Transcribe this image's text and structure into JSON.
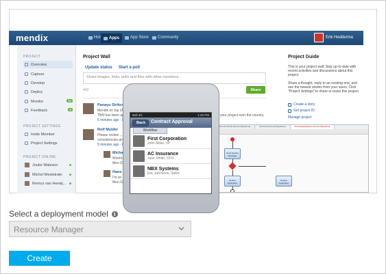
{
  "preview": {
    "app": {
      "logo": "mendix",
      "nav": [
        {
          "label": "Home"
        },
        {
          "label": "Apps"
        },
        {
          "label": "App Store"
        },
        {
          "label": "Community"
        }
      ],
      "user_name": "Erik Hedderma"
    },
    "sidebar": {
      "project_head": "PROJECT",
      "items": [
        {
          "label": "Overview"
        },
        {
          "label": "Capture"
        },
        {
          "label": "Develop"
        },
        {
          "label": "Deploy"
        },
        {
          "label": "Monitor",
          "badge": "42"
        },
        {
          "label": "Feedback",
          "badge": "5"
        }
      ],
      "settings_head": "PROJECT SETTINGS",
      "settings_items": [
        {
          "label": "Invite Member"
        },
        {
          "label": "Project Settings"
        }
      ],
      "online_head": "PROJECT ONLINE",
      "online_members": [
        {
          "name": "Jouke Waleson"
        },
        {
          "name": "Michel Weststrate"
        },
        {
          "name": "Remco van Herwij..."
        }
      ]
    },
    "wall": {
      "title": "Project Wall",
      "update_status": "Update status",
      "start_poll": "Start a poll",
      "share_placeholder": "Share images, links, polls and files with other members.",
      "share_button": "Share",
      "meta": "442",
      "posts": [
        {
          "name": "Panayu Sirikra",
          "line1": "Mendix on top of",
          "line2": "TBN has been app",
          "meta": "5 minutes ago · Like"
        },
        {
          "name": "Rolf Mulder",
          "line1": "Please review ...",
          "line2": "consistencies an",
          "meta": "5 minutes ago · Li"
        },
        {
          "name": "Michael",
          "line1": "Woeho",
          "meta": "Mon 02"
        },
        {
          "name": "Hans",
          "line1": "I'm so",
          "meta": "Mon 02"
        }
      ],
      "tail_text": "your project over the country."
    },
    "guide": {
      "title": "Project Guide",
      "para1": "This is your project wall. Stay up-to-date with recent activities and discussions about this project.",
      "para2": "Share a thought, reply to an existing one, and see the newest stories from your users. Click \"Project Settings\" to share or leave this project.",
      "links": [
        {
          "label": "Create a story"
        },
        {
          "label": "Get project ID"
        },
        {
          "label": "Manage project"
        }
      ]
    },
    "phone": {
      "carrier": "Bell 3G",
      "time": "1:20 PM",
      "back": "Back",
      "title": "Contract Approval",
      "tab": "Workflow",
      "rows": [
        {
          "name": "First Corporation",
          "sub": "John Miller, VP"
        },
        {
          "name": "AC Insurance",
          "sub": "Jane Smith, CFO"
        },
        {
          "name": "NBX Systems",
          "sub": "Eric Johnsons, Sales"
        }
      ]
    },
    "editor": {
      "tabs": [
        "Dashboard",
        "Domain Model [AccountSignature]",
        "DocDesk [AccountSignature]",
        "ProcessApplication [AccountSignature]"
      ],
      "nodes": [
        {
          "label": "Send Decline Message"
        },
        {
          "label": "Decline Application"
        },
        {
          "label": "Decline Application"
        }
      ]
    }
  },
  "form": {
    "label": "Select a deployment model",
    "info_icon": "info-icon",
    "selected": "Resource Manager",
    "create_label": "Create"
  },
  "colors": {
    "create_button": "#00abec",
    "select_bg": "#ebebeb",
    "mendix_nav": "#1e4773",
    "share_button": "#5eaa2e"
  }
}
